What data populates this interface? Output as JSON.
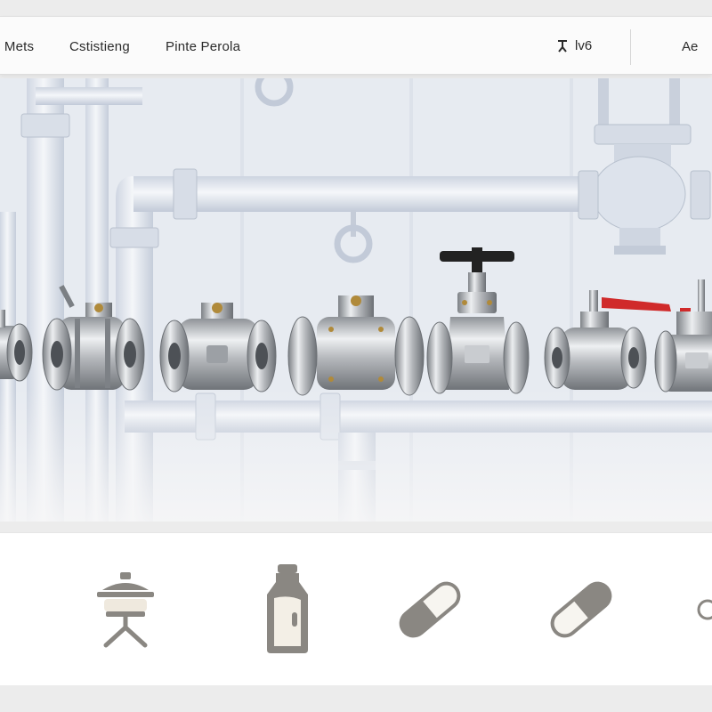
{
  "header": {
    "nav": [
      {
        "label": "o Mets"
      },
      {
        "label": "Cstistieng"
      },
      {
        "label": "Pinte  Perola"
      }
    ],
    "account_label": "lv6",
    "language_label": "Ae"
  },
  "hero": {
    "products": [
      {
        "name": "flanged-ball-valve"
      },
      {
        "name": "three-piece-ball-valve"
      },
      {
        "name": "flanged-ball-valve"
      },
      {
        "name": "bolted-bonnet-valve"
      },
      {
        "name": "gate-valve"
      },
      {
        "name": "lever-ball-valve"
      },
      {
        "name": "actuated-valve"
      }
    ]
  },
  "catalog": {
    "icons": [
      "gauge-icon",
      "valve-stand-icon",
      "bottle-icon",
      "capsule-icon",
      "capsule-icon",
      "circle-icon"
    ]
  },
  "colors": {
    "header_bg": "#fbfbfb",
    "hero_bg": "#e9edf3",
    "icon_gray": "#8a8782",
    "lever_black": "#222222",
    "lever_red": "#d02a2a",
    "steel": "#b9bcc0"
  }
}
